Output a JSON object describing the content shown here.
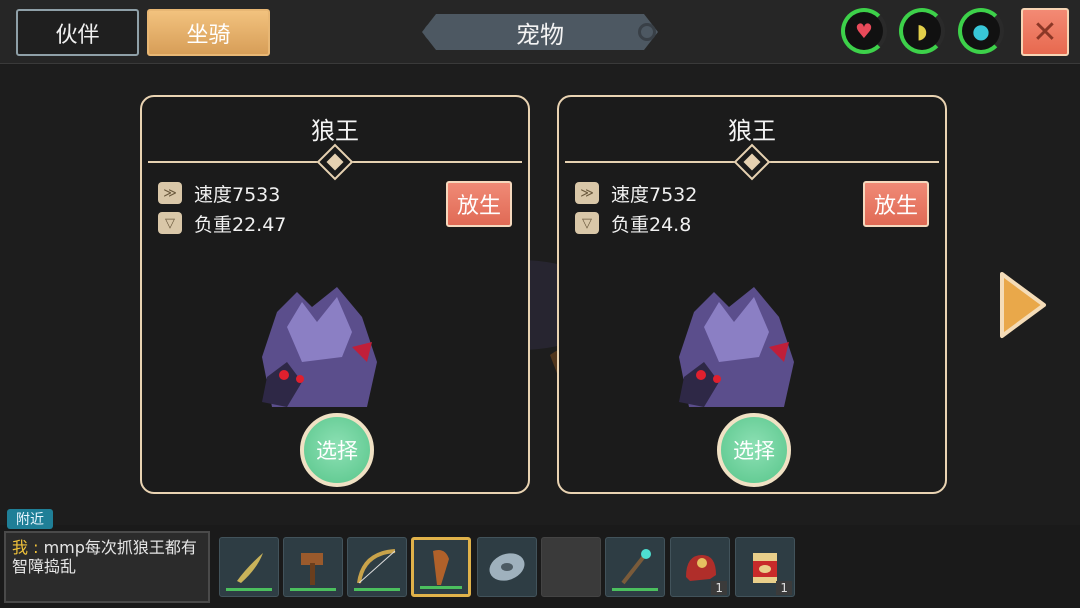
{
  "tabs": {
    "partner": "伙伴",
    "mount": "坐骑"
  },
  "title": "宠物",
  "stat_icons": [
    {
      "name": "heart-icon",
      "glyph": "♥",
      "color": "#e94a5a"
    },
    {
      "name": "banana-icon",
      "glyph": "◗",
      "color": "#e3d04a"
    },
    {
      "name": "water-drop-icon",
      "glyph": "●",
      "color": "#38c7d8"
    }
  ],
  "close_glyph": "✕",
  "cards": [
    {
      "name": "狼王",
      "speed": "速度7533",
      "load": "负重22.47",
      "release": "放生",
      "select": "选择"
    },
    {
      "name": "狼王",
      "speed": "速度7532",
      "load": "负重24.8",
      "release": "放生",
      "select": "选择"
    }
  ],
  "chat": {
    "channel": "附近",
    "speaker": "我",
    "separator": " : ",
    "message": "mmp每次抓狼王都有智障捣乱"
  },
  "hotbar": [
    {
      "icon": "dagger-icon",
      "count": ""
    },
    {
      "icon": "hammer-icon",
      "count": ""
    },
    {
      "icon": "bow-icon",
      "count": ""
    },
    {
      "icon": "club-icon",
      "count": ""
    },
    {
      "icon": "shield-icon",
      "count": ""
    },
    {
      "icon": "empty-slot",
      "count": ""
    },
    {
      "icon": "staff-icon",
      "count": ""
    },
    {
      "icon": "helmet-icon",
      "count": "1"
    },
    {
      "icon": "food-bag-icon",
      "count": "1"
    }
  ],
  "colors": {
    "accent": "#e9d3b2",
    "release": "#e06a55",
    "select": "#57c58a",
    "ring": "#3dd14a"
  }
}
